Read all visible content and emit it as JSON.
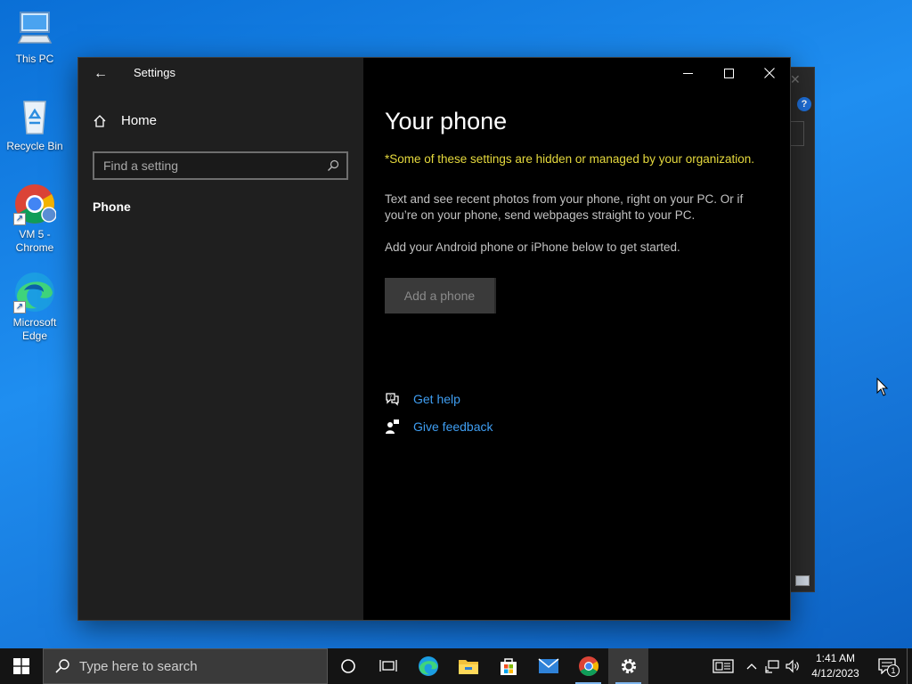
{
  "desktop": {
    "icons": [
      {
        "label": "This PC"
      },
      {
        "label": "Recycle Bin"
      },
      {
        "label": "VM 5 - Chrome"
      },
      {
        "label": "Microsoft Edge"
      }
    ]
  },
  "settings": {
    "title": "Settings",
    "back": "←",
    "controls": {
      "minimize": "—",
      "maximize": "☐",
      "close": "✕"
    },
    "nav": {
      "home_label": "Home",
      "search_placeholder": "Find a setting",
      "phone_label": "Phone"
    },
    "content": {
      "title": "Your phone",
      "managed_note": "*Some of these settings are hidden or managed by your organization.",
      "description": "Text and see recent photos from your phone, right on your PC. Or if you’re on your phone, send webpages straight to your PC.",
      "get_started": "Add your Android phone or iPhone below to get started.",
      "add_phone_button": "Add a phone",
      "get_help": "Get help",
      "give_feedback": "Give feedback"
    }
  },
  "taskbar": {
    "search_placeholder": "Type here to search",
    "apps": [
      "cortana-icon",
      "task-view-icon",
      "edge-icon",
      "file-explorer-icon",
      "store-icon",
      "mail-icon",
      "chrome-icon",
      "settings-icon"
    ],
    "clock": {
      "time": "1:41 AM",
      "date": "4/12/2023"
    },
    "notification_count": "1"
  },
  "colors": {
    "accent": "#3f9ef2",
    "warning": "#e5d93d",
    "nav_bg": "#1f1f1f",
    "content_bg": "#000000"
  }
}
